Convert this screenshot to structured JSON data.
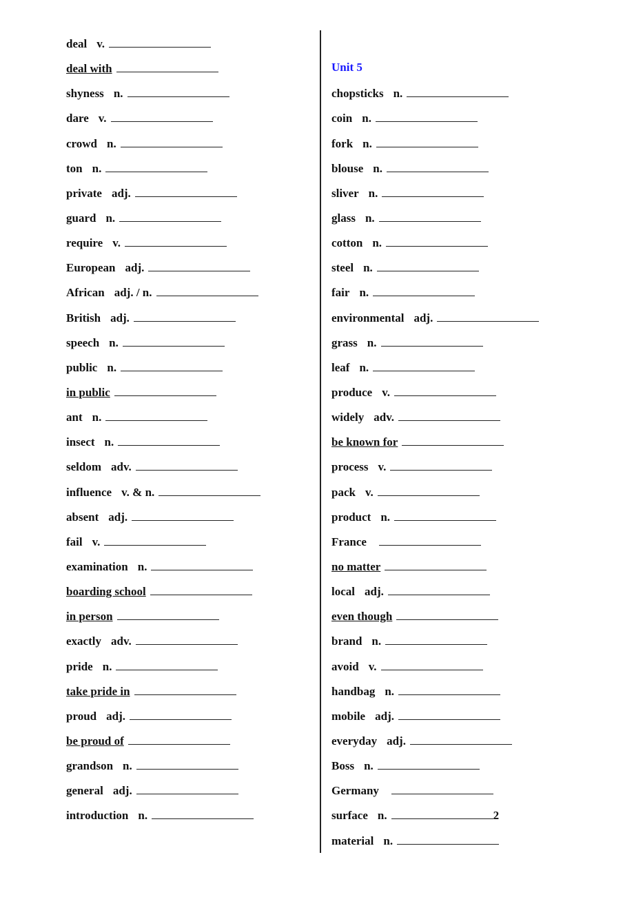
{
  "left_column": [
    {
      "word": "deal",
      "pos": "v."
    },
    {
      "word": "deal with",
      "pos": "",
      "underline": true
    },
    {
      "word": "shyness",
      "pos": "n."
    },
    {
      "word": "dare",
      "pos": "v."
    },
    {
      "word": "crowd",
      "pos": "n."
    },
    {
      "word": "ton",
      "pos": "n."
    },
    {
      "word": "private",
      "pos": "adj."
    },
    {
      "word": "guard",
      "pos": "n."
    },
    {
      "word": "require",
      "pos": "v."
    },
    {
      "word": "European",
      "pos": "adj."
    },
    {
      "word": "African",
      "pos": "adj. / n."
    },
    {
      "word": "British",
      "pos": "adj."
    },
    {
      "word": "speech",
      "pos": "n."
    },
    {
      "word": "public",
      "pos": "n."
    },
    {
      "word": "in public",
      "pos": "",
      "underline": true
    },
    {
      "word": "ant",
      "pos": "n."
    },
    {
      "word": "insect",
      "pos": "n."
    },
    {
      "word": "seldom",
      "pos": "adv."
    },
    {
      "word": "influence",
      "pos": "v. & n."
    },
    {
      "word": "absent",
      "pos": "adj."
    },
    {
      "word": "fail",
      "pos": "v."
    },
    {
      "word": "examination",
      "pos": "n."
    },
    {
      "word": "boarding school",
      "pos": "",
      "underline": true
    },
    {
      "word": "in person",
      "pos": "",
      "underline": true
    },
    {
      "word": "exactly",
      "pos": "adv."
    },
    {
      "word": "pride",
      "pos": "n."
    },
    {
      "word": "take pride in",
      "pos": "",
      "underline": true
    },
    {
      "word": "proud",
      "pos": "adj."
    },
    {
      "word": "be proud of",
      "pos": "",
      "underline": true
    },
    {
      "word": "grandson",
      "pos": "n."
    },
    {
      "word": "general",
      "pos": "adj."
    },
    {
      "word": "introduction",
      "pos": "n."
    }
  ],
  "unit_heading": "Unit 5",
  "unit_color": "#1a1aff",
  "right_column": [
    {
      "word": "chopsticks",
      "pos": "n."
    },
    {
      "word": "coin",
      "pos": "n."
    },
    {
      "word": "fork",
      "pos": "n."
    },
    {
      "word": "blouse",
      "pos": "n."
    },
    {
      "word": "sliver",
      "pos": "n."
    },
    {
      "word": "glass",
      "pos": "n."
    },
    {
      "word": "cotton",
      "pos": "n."
    },
    {
      "word": "steel",
      "pos": "n."
    },
    {
      "word": "fair",
      "pos": "n."
    },
    {
      "word": "environmental",
      "pos": "adj."
    },
    {
      "word": "grass",
      "pos": "n."
    },
    {
      "word": "leaf",
      "pos": "n."
    },
    {
      "word": "produce",
      "pos": "v."
    },
    {
      "word": "widely",
      "pos": "adv."
    },
    {
      "word": "be known for",
      "pos": "",
      "underline": true
    },
    {
      "word": "process",
      "pos": "v."
    },
    {
      "word": "pack",
      "pos": "v."
    },
    {
      "word": "product",
      "pos": "n."
    },
    {
      "word": "France",
      "pos": ""
    },
    {
      "word": "no matter",
      "pos": "",
      "underline": true
    },
    {
      "word": "local",
      "pos": "adj."
    },
    {
      "word": "even though",
      "pos": "",
      "underline": true
    },
    {
      "word": "brand",
      "pos": "n."
    },
    {
      "word": "avoid",
      "pos": "v."
    },
    {
      "word": "handbag",
      "pos": "n."
    },
    {
      "word": "mobile",
      "pos": "adj."
    },
    {
      "word": "everyday",
      "pos": "adj."
    },
    {
      "word": "Boss",
      "pos": "n."
    },
    {
      "word": "Germany",
      "pos": ""
    },
    {
      "word": "surface",
      "pos": "n.",
      "suffix": "2"
    },
    {
      "word": "material",
      "pos": "n."
    }
  ]
}
